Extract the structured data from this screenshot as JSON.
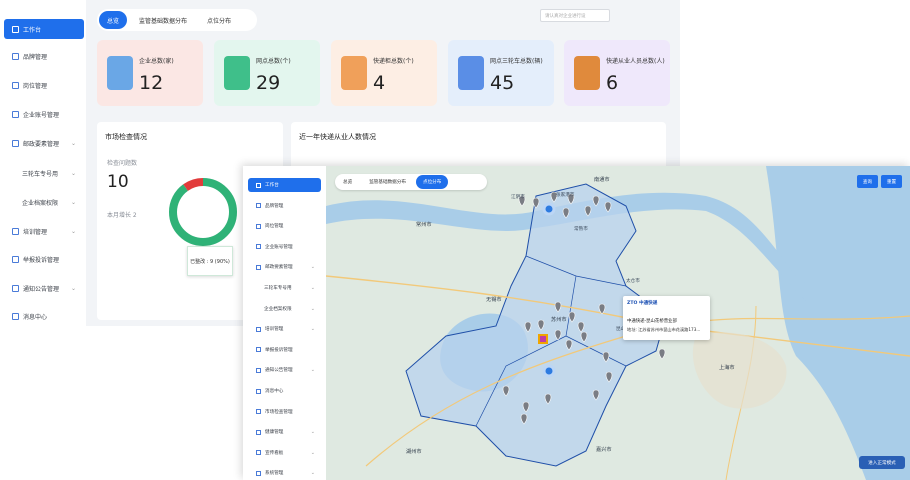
{
  "back": {
    "sidebar": [
      {
        "label": "工作台",
        "active": true,
        "chev": false,
        "sub": false
      },
      {
        "label": "品牌管理",
        "active": false,
        "chev": false,
        "sub": false
      },
      {
        "label": "岗位管理",
        "active": false,
        "chev": false,
        "sub": false
      },
      {
        "label": "企业账号管理",
        "active": false,
        "chev": false,
        "sub": false
      },
      {
        "label": "邮政要素管理",
        "active": false,
        "chev": true,
        "sub": false
      },
      {
        "label": "三轮车专号用",
        "active": false,
        "chev": true,
        "sub": true
      },
      {
        "label": "企业档案权限",
        "active": false,
        "chev": true,
        "sub": true
      },
      {
        "label": "培训管理",
        "active": false,
        "chev": true,
        "sub": false
      },
      {
        "label": "举报投诉管理",
        "active": false,
        "chev": false,
        "sub": false
      },
      {
        "label": "通知公告管理",
        "active": false,
        "chev": true,
        "sub": false
      },
      {
        "label": "消息中心",
        "active": false,
        "chev": false,
        "sub": false
      }
    ],
    "tabs": [
      "总览",
      "监管基础数据分布",
      "点位分布"
    ],
    "stats": [
      {
        "label": "企业总数(家)",
        "value": "12",
        "bg": "#fbe7e4",
        "art": "#6aa7e6"
      },
      {
        "label": "网点总数(个)",
        "value": "29",
        "bg": "#e3f6ee",
        "art": "#3fbf8a"
      },
      {
        "label": "快递柜总数(个)",
        "value": "4",
        "bg": "#fdeee4",
        "art": "#f0a05a"
      },
      {
        "label": "网点三轮车总数(辆)",
        "value": "45",
        "bg": "#e4eefb",
        "art": "#5a8ee6"
      },
      {
        "label": "快递从业人员总数(人)",
        "value": "6",
        "bg": "#efe8fb",
        "art": "#e08a3c"
      }
    ],
    "market": {
      "title": "市场检查情况",
      "problem_label": "检查问题数",
      "problem_value": "10",
      "monthly": "本月增长 2",
      "tooltip": "已整改 : 9 (90%)",
      "fixed_ratio": 0.9
    },
    "yearly_title": "近一年快递从业人数情况"
  },
  "front": {
    "sidebar": [
      {
        "label": "工作台",
        "active": true,
        "chev": false,
        "sub": false
      },
      {
        "label": "品牌管理",
        "active": false,
        "chev": false,
        "sub": false
      },
      {
        "label": "岗位管理",
        "active": false,
        "chev": false,
        "sub": false
      },
      {
        "label": "企业账号管理",
        "active": false,
        "chev": false,
        "sub": false
      },
      {
        "label": "邮政要素管理",
        "active": false,
        "chev": true,
        "sub": false
      },
      {
        "label": "三轮车专号用",
        "active": false,
        "chev": true,
        "sub": true
      },
      {
        "label": "企业档案权限",
        "active": false,
        "chev": true,
        "sub": true
      },
      {
        "label": "培训管理",
        "active": false,
        "chev": true,
        "sub": false
      },
      {
        "label": "举报投诉管理",
        "active": false,
        "chev": false,
        "sub": false
      },
      {
        "label": "通知公告管理",
        "active": false,
        "chev": true,
        "sub": false
      },
      {
        "label": "消息中心",
        "active": false,
        "chev": false,
        "sub": false
      },
      {
        "label": "市场检查管理",
        "active": false,
        "chev": false,
        "sub": false
      },
      {
        "label": "健康管理",
        "active": false,
        "chev": true,
        "sub": false
      },
      {
        "label": "宣传看板",
        "active": false,
        "chev": true,
        "sub": false
      },
      {
        "label": "系统管理",
        "active": false,
        "chev": true,
        "sub": false
      }
    ],
    "tabs": [
      "总览",
      "监管基础数据分布",
      "点位分布"
    ],
    "search_placeholder": "请认真对企业进行设",
    "query_label": "查询",
    "reset_label": "重置",
    "popup": {
      "logo": "ZTO 中通快递",
      "name": "中通快递-昆山花桥营业部",
      "address": "地址: 江苏省苏州市昆山市花溪路173..."
    },
    "enter_label": "进入正常模式",
    "map_labels": {
      "nantong": "南通市",
      "wuxi": "无锡市",
      "shanghai": "上海市",
      "huzhou": "湖州市",
      "changzhou": "常州市",
      "suzhou": "苏州市",
      "taicang": "太仓市",
      "kunshan": "昆山市",
      "jiaxing": "嘉兴市",
      "changshu": "常熟市",
      "jiangyin": "江阴市",
      "zhangjiagang": "张家港市"
    }
  }
}
